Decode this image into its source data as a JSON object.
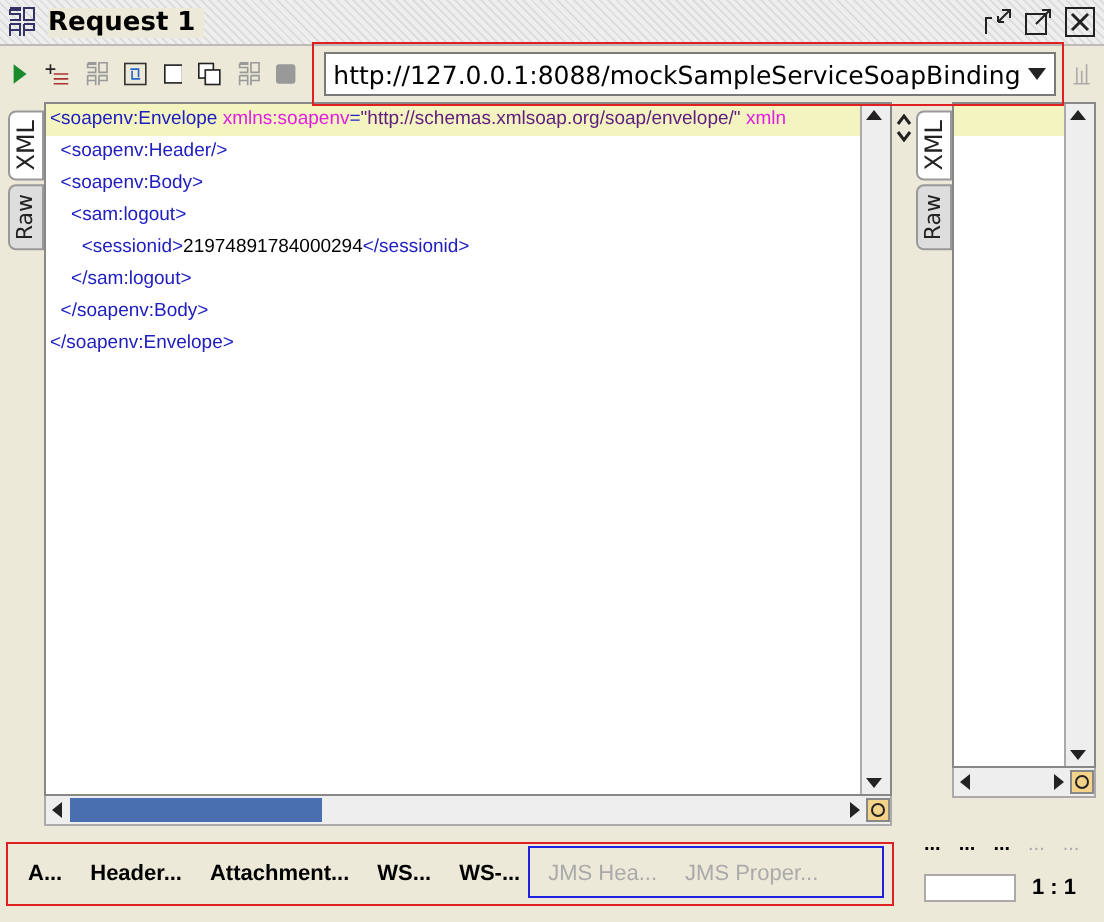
{
  "window": {
    "title": "Request 1"
  },
  "toolbar": {
    "endpoint": "http://127.0.0.1:8088/mockSampleServiceSoapBinding"
  },
  "request_editor": {
    "view_tabs": [
      {
        "label": "XML",
        "selected": true
      },
      {
        "label": "Raw",
        "selected": false
      }
    ],
    "lines": [
      [
        {
          "kind": "tag",
          "text": "<soapenv:Envelope "
        },
        {
          "kind": "attr",
          "text": "xmlns:soapenv"
        },
        {
          "kind": "tag",
          "text": "="
        },
        {
          "kind": "value",
          "text": "\"http://schemas.xmlsoap.org/soap/envelope/\" "
        },
        {
          "kind": "attr",
          "text": "xmln"
        }
      ],
      [
        {
          "kind": "tag",
          "text": "  <soapenv:Header/>"
        }
      ],
      [
        {
          "kind": "tag",
          "text": "  <soapenv:Body>"
        }
      ],
      [
        {
          "kind": "tag",
          "text": "    <sam:logout>"
        }
      ],
      [
        {
          "kind": "tag",
          "text": "      <sessionid>"
        },
        {
          "kind": "text",
          "text": "21974891784000294"
        },
        {
          "kind": "tag",
          "text": "</sessionid>"
        }
      ],
      [
        {
          "kind": "tag",
          "text": "    </sam:logout>"
        }
      ],
      [
        {
          "kind": "tag",
          "text": "  </soapenv:Body>"
        }
      ],
      [
        {
          "kind": "tag",
          "text": "</soapenv:Envelope>"
        }
      ]
    ],
    "bottom_tabs": [
      {
        "label": "A...",
        "disabled": false
      },
      {
        "label": "Header...",
        "disabled": false
      },
      {
        "label": "Attachment...",
        "disabled": false
      },
      {
        "label": "WS...",
        "disabled": false
      },
      {
        "label": "WS-...",
        "disabled": false
      },
      {
        "label": "JMS Hea...",
        "disabled": true
      },
      {
        "label": "JMS Proper...",
        "disabled": true
      }
    ]
  },
  "response_editor": {
    "view_tabs": [
      {
        "label": "XML",
        "selected": true
      },
      {
        "label": "Raw",
        "selected": false
      }
    ],
    "bottom_tabs": [
      {
        "label": "...",
        "disabled": false
      },
      {
        "label": "...",
        "disabled": false
      },
      {
        "label": "...",
        "disabled": false
      },
      {
        "label": "...",
        "disabled": true
      },
      {
        "label": "...",
        "disabled": true
      }
    ],
    "position": "1 : 1"
  }
}
